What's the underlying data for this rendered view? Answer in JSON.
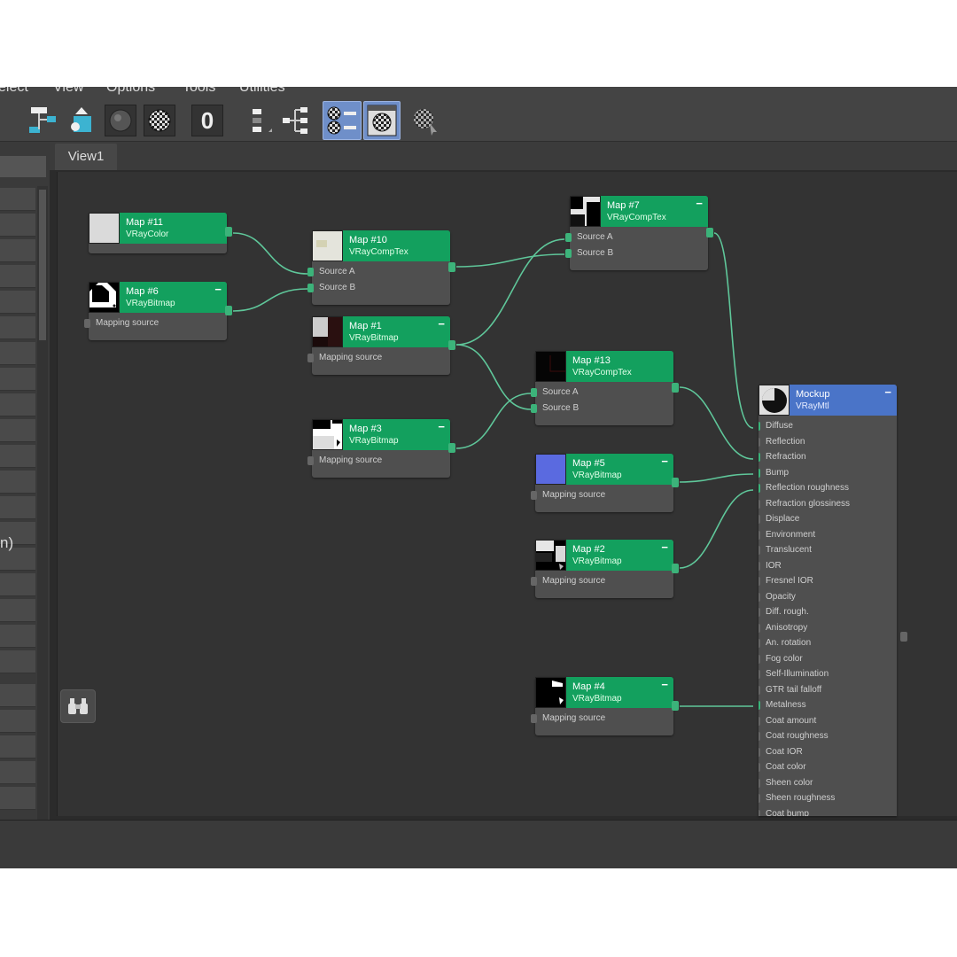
{
  "menu": {
    "items": [
      "elect",
      "View",
      "Options",
      "Tools",
      "Utilities"
    ]
  },
  "toolbar": {
    "icons": [
      "layout-children-icon",
      "move-up-icon",
      "material-sphere-icon",
      "checker-sphere-icon",
      "zero-counter-icon",
      "hide-unused-sockets-icon",
      "tree-layout-icon",
      "show-map-in-viewport-icon",
      "show-background-icon",
      "material-picker-icon"
    ],
    "counter_value": "0"
  },
  "sidebar": {
    "partial_text": "n)"
  },
  "tabs": {
    "view1": "View1"
  },
  "colors": {
    "node_header": "#13a05e",
    "material_header": "#4a74c8",
    "wire": "#5fc79a",
    "canvas": "#333333"
  },
  "nodes": {
    "map11": {
      "title": "Map #11",
      "type": "VRayColor"
    },
    "map6": {
      "title": "Map #6",
      "type": "VRayBitmap",
      "socket": "Mapping source"
    },
    "map10": {
      "title": "Map #10",
      "type": "VRayCompTex",
      "sockets": [
        "Source A",
        "Source B"
      ]
    },
    "map1": {
      "title": "Map #1",
      "type": "VRayBitmap",
      "socket": "Mapping source"
    },
    "map3": {
      "title": "Map #3",
      "type": "VRayBitmap",
      "socket": "Mapping source"
    },
    "map7": {
      "title": "Map #7",
      "type": "VRayCompTex",
      "sockets": [
        "Source A",
        "Source B"
      ]
    },
    "map13": {
      "title": "Map #13",
      "type": "VRayCompTex",
      "sockets": [
        "Source A",
        "Source B"
      ]
    },
    "map5": {
      "title": "Map #5",
      "type": "VRayBitmap",
      "socket": "Mapping source"
    },
    "map2": {
      "title": "Map #2",
      "type": "VRayBitmap",
      "socket": "Mapping source"
    },
    "map4": {
      "title": "Map #4",
      "type": "VRayBitmap",
      "socket": "Mapping source"
    },
    "mockup": {
      "title": "Mockup",
      "type": "VRayMtl",
      "sockets": [
        "Diffuse",
        "Reflection",
        "Refraction",
        "Bump",
        "Reflection roughness",
        "Refraction glossiness",
        "Displace",
        "Environment",
        "Translucent",
        "IOR",
        "Fresnel IOR",
        "Opacity",
        "Diff. rough.",
        "Anisotropy",
        "An. rotation",
        "Fog color",
        "Self-Illumination",
        "GTR tail falloff",
        "Metalness",
        "Coat amount",
        "Coat roughness",
        "Coat IOR",
        "Coat color",
        "Sheen color",
        "Sheen roughness",
        "Coat bump"
      ]
    }
  },
  "collapse_symbol": "−"
}
